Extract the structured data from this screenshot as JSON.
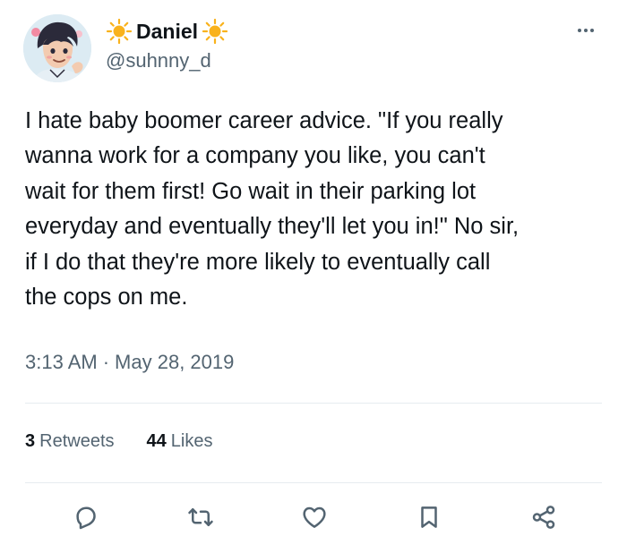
{
  "author": {
    "display_name": "Daniel",
    "handle": "@suhnny_d",
    "name_decoration_icon": "sun-emoji-icon",
    "avatar_icon": "cartoon-avatar-icon"
  },
  "menu_icon": "more-horizontal-icon",
  "tweet": {
    "text": "I hate baby boomer career advice. \"If you really\nwanna work for a company you like, you can't\nwait for them first! Go wait in their parking lot\neveryday and eventually they'll let you in!\" No sir,\nif I do that they're more likely to eventually call\nthe cops on me.",
    "time": "3:13 AM",
    "separator": "·",
    "date": "May 28, 2019"
  },
  "stats": {
    "retweets_count": "3",
    "retweets_label": "Retweets",
    "likes_count": "44",
    "likes_label": "Likes"
  },
  "actions": [
    {
      "icon": "reply-icon"
    },
    {
      "icon": "retweet-icon"
    },
    {
      "icon": "like-icon"
    },
    {
      "icon": "bookmark-icon"
    },
    {
      "icon": "share-icon"
    }
  ],
  "colors": {
    "text_primary": "#0f1419",
    "text_secondary": "#536471",
    "divider": "#e6ecf0",
    "sun": "#f9b21c"
  }
}
